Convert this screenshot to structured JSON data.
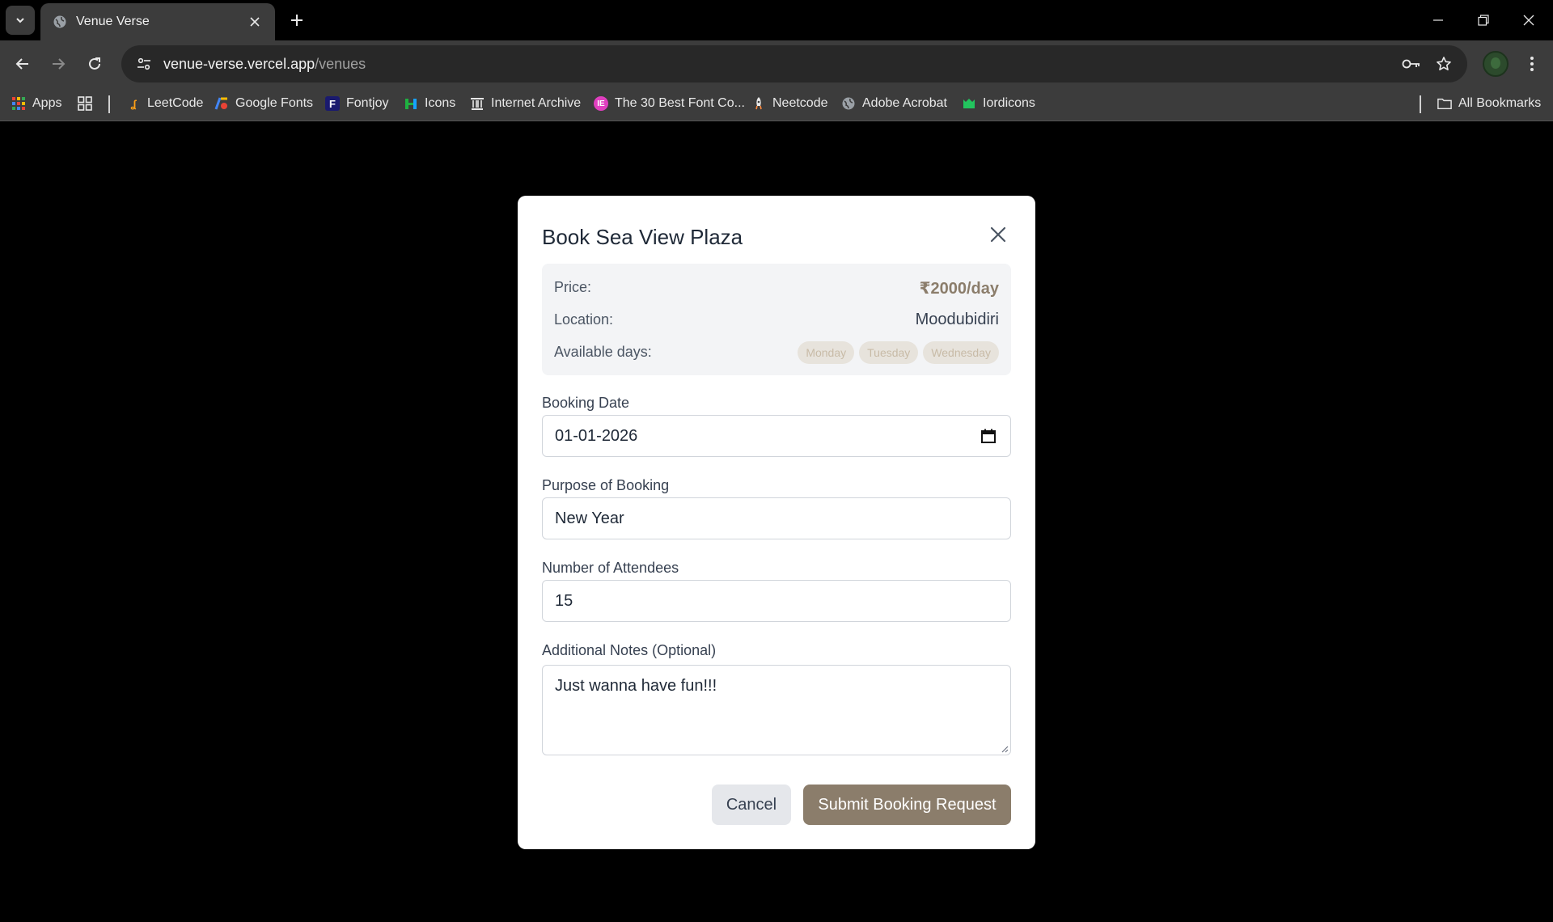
{
  "browser": {
    "tab_title": "Venue Verse",
    "url_host": "venue-verse.vercel.app",
    "url_path": "/venues",
    "bookmarks": [
      {
        "label": "Apps"
      },
      {
        "label": "LeetCode"
      },
      {
        "label": "Google Fonts"
      },
      {
        "label": "Fontjoy"
      },
      {
        "label": "Icons"
      },
      {
        "label": "Internet Archive"
      },
      {
        "label": "The 30 Best Font Co..."
      },
      {
        "label": "Neetcode"
      },
      {
        "label": "Adobe Acrobat"
      },
      {
        "label": "Iordicons"
      }
    ],
    "all_bookmarks_label": "All Bookmarks"
  },
  "modal": {
    "title": "Book Sea View Plaza",
    "info": {
      "price_label": "Price:",
      "price_value": "₹2000/day",
      "location_label": "Location:",
      "location_value": "Moodubidiri",
      "days_label": "Available days:",
      "days": [
        "Monday",
        "Tuesday",
        "Wednesday"
      ]
    },
    "fields": {
      "date_label": "Booking Date",
      "date_value": "01-01-2026",
      "purpose_label": "Purpose of Booking",
      "purpose_value": "New Year",
      "attendees_label": "Number of Attendees",
      "attendees_value": "15",
      "notes_label": "Additional Notes (Optional)",
      "notes_value": "Just wanna have fun!!!"
    },
    "cancel_label": "Cancel",
    "submit_label": "Submit Booking Request"
  },
  "colors": {
    "accent": "#8b7d6b",
    "chip_bg": "#e7e3dc",
    "card_bg": "#f3f4f6"
  }
}
